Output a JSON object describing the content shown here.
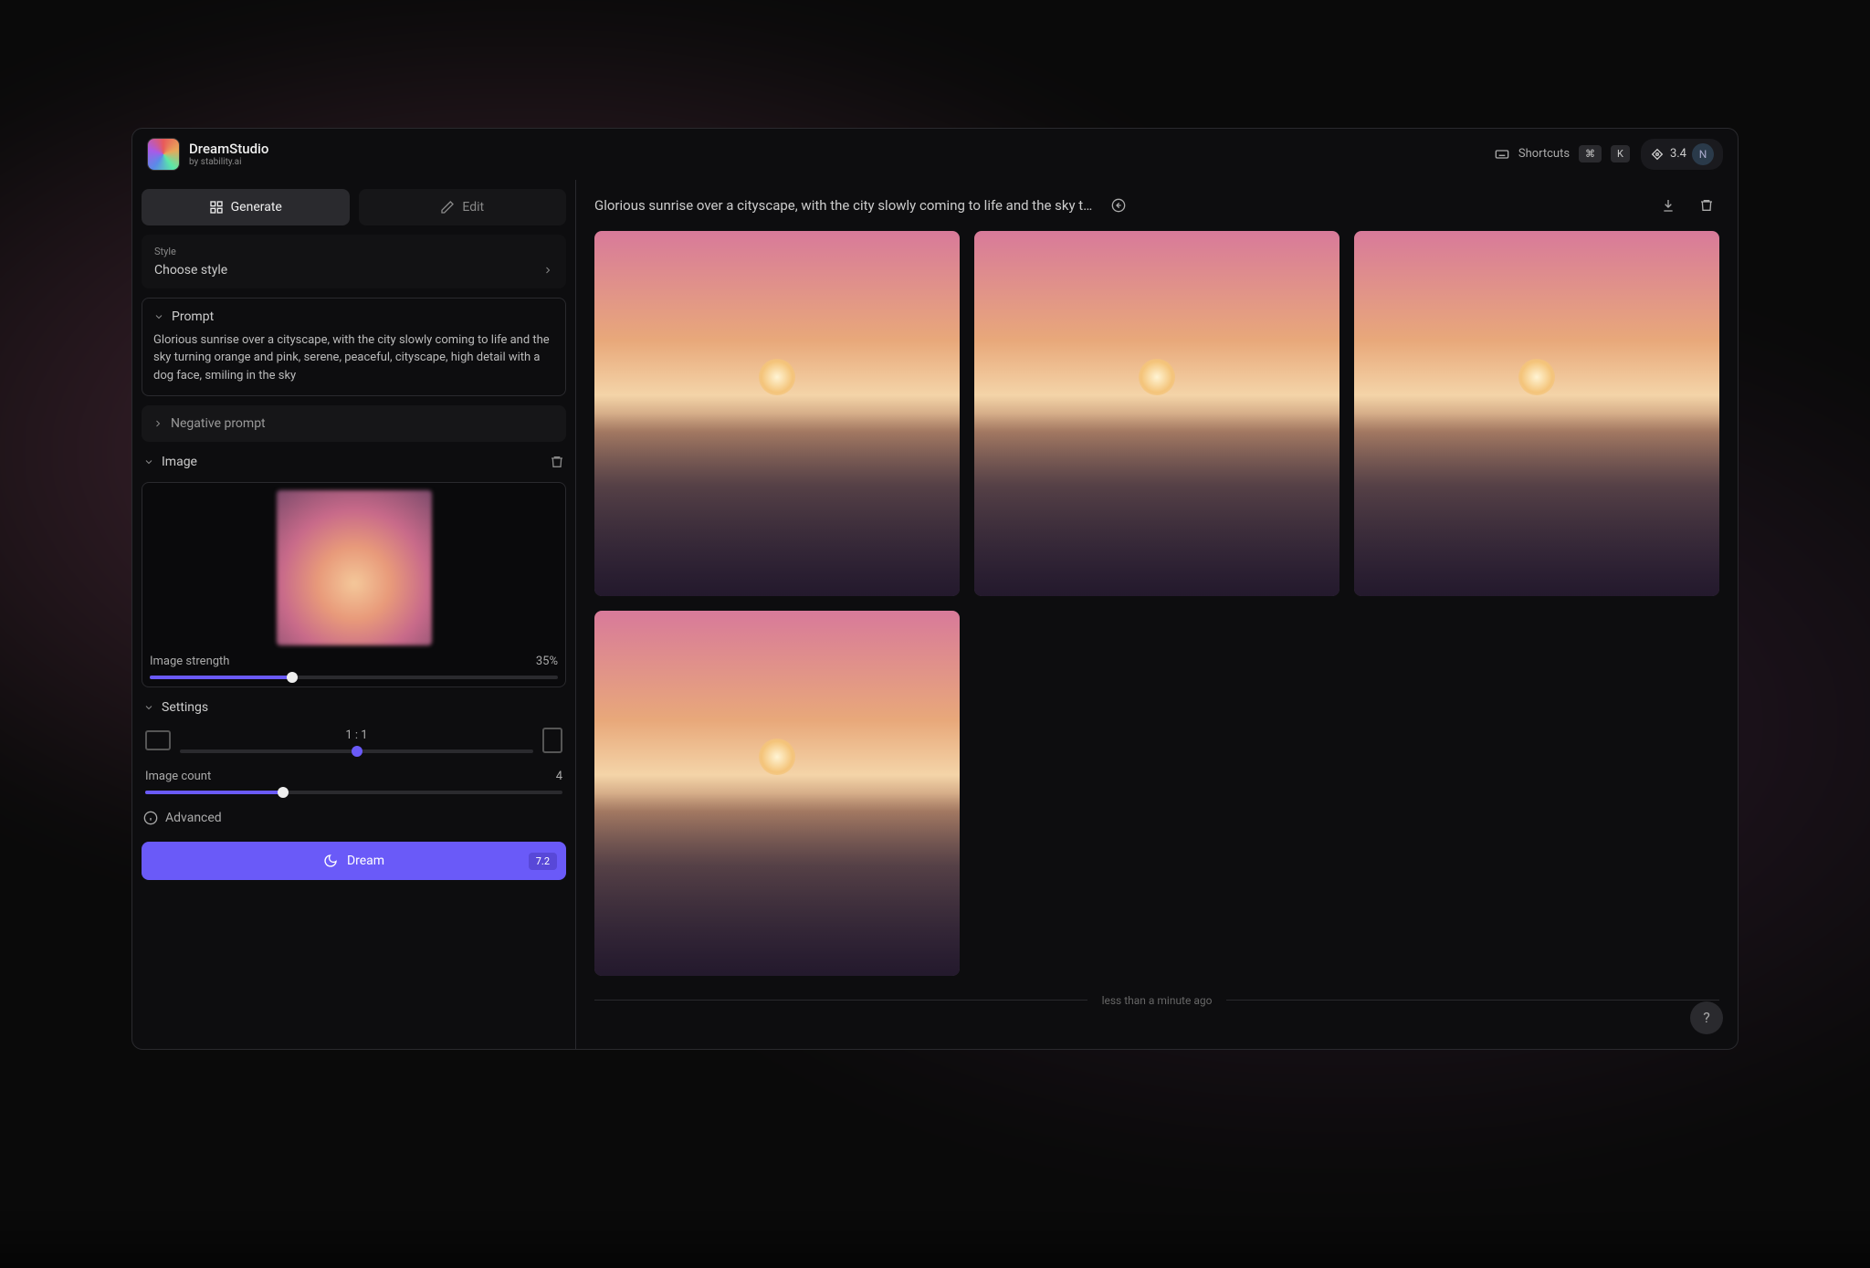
{
  "brand": {
    "title": "DreamStudio",
    "sub_prefix": "by",
    "sub_name": "stability.ai"
  },
  "topbar": {
    "shortcuts_label": "Shortcuts",
    "kbd1": "⌘",
    "kbd2": "K",
    "credits": "3.4",
    "avatar_initial": "N"
  },
  "tabs": {
    "generate": "Generate",
    "edit": "Edit"
  },
  "style": {
    "label": "Style",
    "value": "Choose style"
  },
  "prompt": {
    "label": "Prompt",
    "text": "Glorious sunrise over a cityscape, with the city slowly coming to life and the sky turning orange and pink, serene, peaceful, cityscape, high detail with a dog face, smiling in the sky"
  },
  "negative_prompt": {
    "label": "Negative prompt"
  },
  "image": {
    "label": "Image",
    "strength_label": "Image strength",
    "strength_value": "35%",
    "strength_pct": 35
  },
  "settings": {
    "label": "Settings",
    "ratio": "1 : 1",
    "ratio_pct": 50,
    "count_label": "Image count",
    "count_value": "4",
    "count_pct": 33
  },
  "advanced": {
    "label": "Advanced"
  },
  "dream": {
    "label": "Dream",
    "cost": "7.2"
  },
  "content": {
    "title": "Glorious sunrise over a cityscape, with the city slowly coming to life and the sky turning ora...",
    "timestamp": "less than a minute ago",
    "help": "?"
  }
}
